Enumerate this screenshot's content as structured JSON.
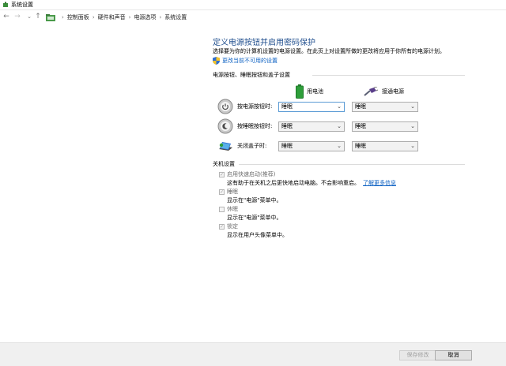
{
  "window": {
    "title": "系统设置"
  },
  "nav": {
    "back": "←",
    "forward": "→",
    "recent": "⌄",
    "up": "↑"
  },
  "breadcrumb": [
    {
      "label": "控制面板"
    },
    {
      "label": "硬件和声音"
    },
    {
      "label": "电源选项"
    },
    {
      "label": "系统设置"
    }
  ],
  "breadcrumb_separator": "›",
  "main": {
    "heading": "定义电源按钮并启用密码保护",
    "subtext": "选择要为你的计算机设置的电源设置。在此页上对设置所做的更改将应用于你所有的电源计划。",
    "change_link": "更改当前不可用的设置"
  },
  "buttons_section": {
    "title": "电源按钮、睡眠按钮和盖子设置",
    "col_battery": "用电池",
    "col_plugged": "接通电源",
    "rows": [
      {
        "label": "按电源按钮时:",
        "battery": "睡眠",
        "plugged": "睡眠"
      },
      {
        "label": "按睡眠按钮时:",
        "battery": "睡眠",
        "plugged": "睡眠"
      },
      {
        "label": "关闭盖子时:",
        "battery": "睡眠",
        "plugged": "睡眠"
      }
    ]
  },
  "shutdown_section": {
    "title": "关机设置",
    "items": [
      {
        "label": "启用快速启动(推荐)",
        "checked": true,
        "desc": "这有助于在关机之后更快地启动电脑。不会影响重启。",
        "more": "了解更多信息"
      },
      {
        "label": "睡眠",
        "checked": true,
        "desc": "显示在\"电源\"菜单中。"
      },
      {
        "label": "休眠",
        "checked": false,
        "desc": "显示在\"电源\"菜单中。"
      },
      {
        "label": "锁定",
        "checked": true,
        "desc": "显示在用户头像菜单中。"
      }
    ]
  },
  "footer": {
    "save": "保存修改",
    "cancel": "取消"
  },
  "icons": {
    "chevron": "⌄",
    "check": "✓"
  },
  "colors": {
    "heading": "#1f4e8e",
    "link": "#0a5fc2",
    "battery": "#2e9e3a"
  }
}
